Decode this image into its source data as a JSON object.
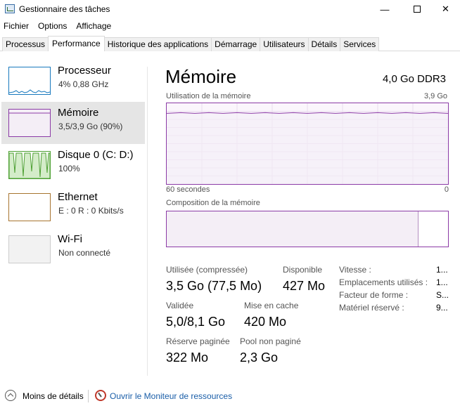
{
  "window": {
    "title": "Gestionnaire des tâches",
    "minimize": "—",
    "close": "✕"
  },
  "menu": [
    "Fichier",
    "Options",
    "Affichage"
  ],
  "tabs": [
    "Processus",
    "Performance",
    "Historique des applications",
    "Démarrage",
    "Utilisateurs",
    "Détails",
    "Services"
  ],
  "sidebar": [
    {
      "title": "Processeur",
      "sub": "4% 0,88 GHz",
      "color": "#1778bd"
    },
    {
      "title": "Mémoire",
      "sub": "3,5/3,9 Go (90%)",
      "color": "#8b3aa6"
    },
    {
      "title": "Disque 0 (C: D:)",
      "sub": "100%",
      "color": "#4da032"
    },
    {
      "title": "Ethernet",
      "sub": "E : 0 R : 0 Kbits/s",
      "color": "#a7742f"
    },
    {
      "title": "Wi-Fi",
      "sub": "Non connecté",
      "color": "#cccccc"
    }
  ],
  "main": {
    "title": "Mémoire",
    "spec": "4,0 Go DDR3",
    "usage_label": "Utilisation de la mémoire",
    "usage_max": "3,9 Go",
    "axis_left": "60 secondes",
    "axis_right": "0",
    "usage_level": 0.88,
    "composition_label": "Composition de la mémoire",
    "composition_used": 0.895,
    "stats": {
      "used_label": "Utilisée (compressée)",
      "used_value": "3,5 Go (77,5 Mo)",
      "available_label": "Disponible",
      "available_value": "427 Mo",
      "committed_label": "Validée",
      "committed_value": "5,0/8,1 Go",
      "cached_label": "Mise en cache",
      "cached_value": "420 Mo",
      "paged_label": "Réserve paginée",
      "paged_value": "322 Mo",
      "nonpaged_label": "Pool non paginé",
      "nonpaged_value": "2,3 Go"
    },
    "details": [
      {
        "label": "Vitesse :",
        "value": "1..."
      },
      {
        "label": "Emplacements utilisés :",
        "value": "1..."
      },
      {
        "label": "Facteur de forme :",
        "value": "S..."
      },
      {
        "label": "Matériel réservé :",
        "value": "9..."
      }
    ]
  },
  "footer": {
    "less": "Moins de détails",
    "monitor": "Ouvrir le Moniteur de ressources"
  }
}
